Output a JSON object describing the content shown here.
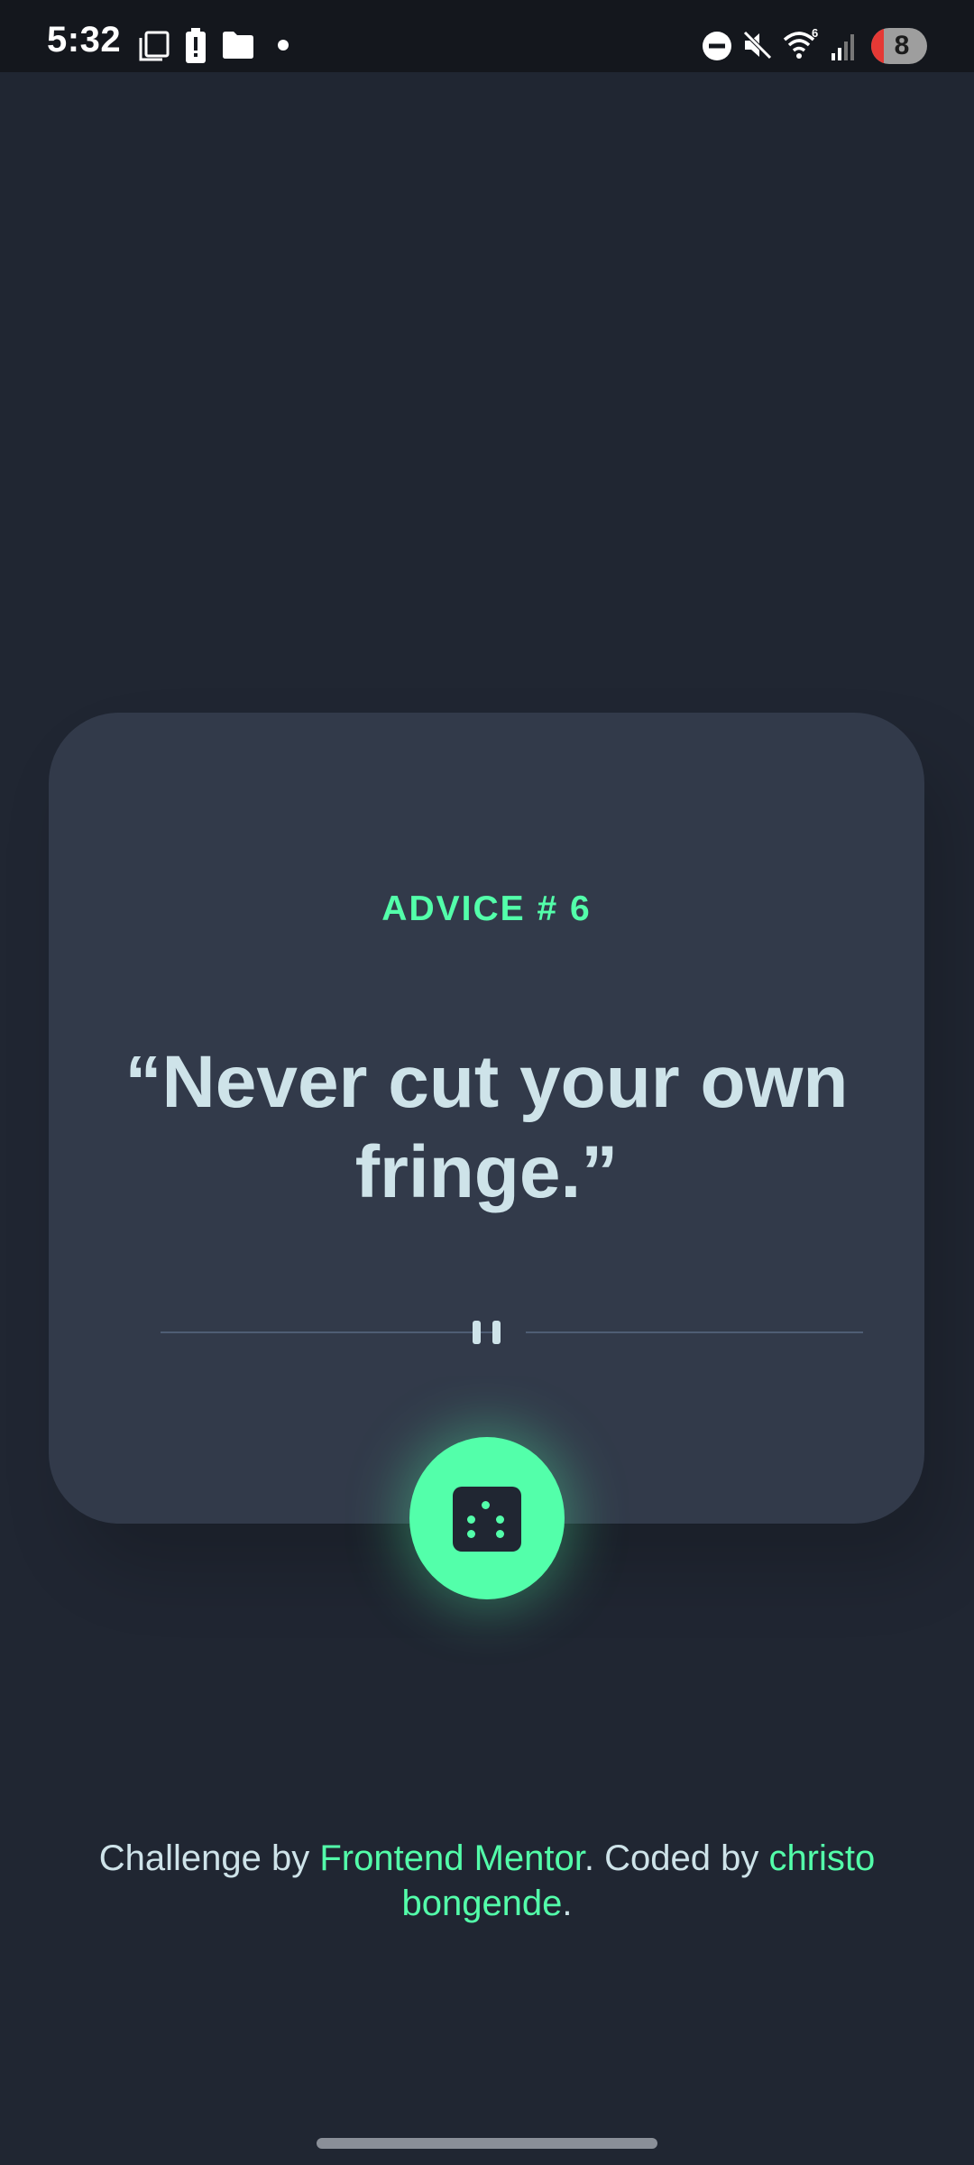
{
  "status_bar": {
    "time": "5:32",
    "notification_count": "8",
    "icons": [
      "screenshot-icon",
      "battery-alert-icon",
      "folder-icon",
      "notification-dot-icon",
      "do-not-disturb-icon",
      "mute-icon",
      "wifi-6-icon",
      "signal-icon"
    ]
  },
  "card": {
    "advice_label": "ADVICE # 6",
    "quote": "“Never cut your own fringe.”"
  },
  "dice_button": {
    "icon": "dice-icon"
  },
  "footer": {
    "prefix": "Challenge by ",
    "link1": "Frontend Mentor",
    "middle": ". Coded by ",
    "link2": "christo bongende",
    "suffix": "."
  },
  "colors": {
    "background": "#202632",
    "card": "#323a4a",
    "accent": "#53ffaa",
    "text": "#cee3e9",
    "divider": "#4f5d74"
  }
}
